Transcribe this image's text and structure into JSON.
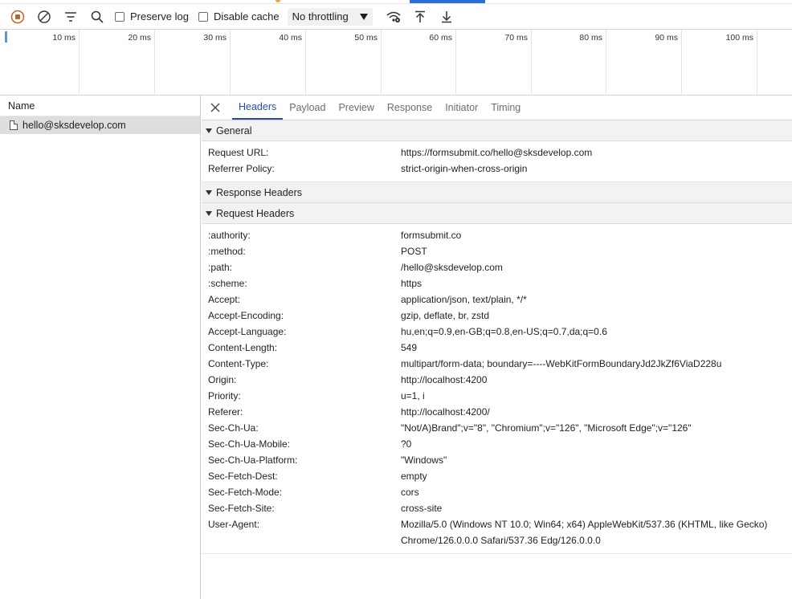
{
  "toolbar": {
    "preserve_log": "Preserve log",
    "disable_cache": "Disable cache",
    "throttling": "No throttling"
  },
  "timeline": {
    "ticks": [
      "10 ms",
      "20 ms",
      "30 ms",
      "40 ms",
      "50 ms",
      "60 ms",
      "70 ms",
      "80 ms",
      "90 ms",
      "100 ms"
    ]
  },
  "requests": {
    "column_header": "Name",
    "items": [
      "hello@sksdevelop.com"
    ]
  },
  "tabs": [
    "Headers",
    "Payload",
    "Preview",
    "Response",
    "Initiator",
    "Timing"
  ],
  "general": {
    "title": "General",
    "rows": [
      {
        "k": "Request URL:",
        "v": "https://formsubmit.co/hello@sksdevelop.com"
      },
      {
        "k": "Referrer Policy:",
        "v": "strict-origin-when-cross-origin"
      }
    ]
  },
  "response_headers": {
    "title": "Response Headers"
  },
  "request_headers": {
    "title": "Request Headers",
    "rows": [
      {
        "k": ":authority:",
        "v": "formsubmit.co"
      },
      {
        "k": ":method:",
        "v": "POST"
      },
      {
        "k": ":path:",
        "v": "/hello@sksdevelop.com"
      },
      {
        "k": ":scheme:",
        "v": "https"
      },
      {
        "k": "Accept:",
        "v": "application/json, text/plain, */*"
      },
      {
        "k": "Accept-Encoding:",
        "v": "gzip, deflate, br, zstd"
      },
      {
        "k": "Accept-Language:",
        "v": "hu,en;q=0.9,en-GB;q=0.8,en-US;q=0.7,da;q=0.6"
      },
      {
        "k": "Content-Length:",
        "v": "549"
      },
      {
        "k": "Content-Type:",
        "v": "multipart/form-data; boundary=----WebKitFormBoundaryJd2JkZf6ViaD228u"
      },
      {
        "k": "Origin:",
        "v": "http://localhost:4200"
      },
      {
        "k": "Priority:",
        "v": "u=1, i"
      },
      {
        "k": "Referer:",
        "v": "http://localhost:4200/"
      },
      {
        "k": "Sec-Ch-Ua:",
        "v": "\"Not/A)Brand\";v=\"8\", \"Chromium\";v=\"126\", \"Microsoft Edge\";v=\"126\""
      },
      {
        "k": "Sec-Ch-Ua-Mobile:",
        "v": "?0"
      },
      {
        "k": "Sec-Ch-Ua-Platform:",
        "v": "\"Windows\""
      },
      {
        "k": "Sec-Fetch-Dest:",
        "v": "empty"
      },
      {
        "k": "Sec-Fetch-Mode:",
        "v": "cors"
      },
      {
        "k": "Sec-Fetch-Site:",
        "v": "cross-site"
      },
      {
        "k": "User-Agent:",
        "v": "Mozilla/5.0 (Windows NT 10.0; Win64; x64) AppleWebKit/537.36 (KHTML, like Gecko) Chrome/126.0.0.0 Safari/537.36 Edg/126.0.0.0"
      }
    ]
  },
  "colors": {
    "accent": "#1f4fa8",
    "record_icon": "#c0632b"
  },
  "icons": [
    "stop-recording-icon",
    "clear-icon",
    "filter-icon",
    "search-icon",
    "chevron-down-icon",
    "network-conditions-icon",
    "import-har-icon",
    "export-har-icon",
    "document-icon",
    "close-icon"
  ]
}
